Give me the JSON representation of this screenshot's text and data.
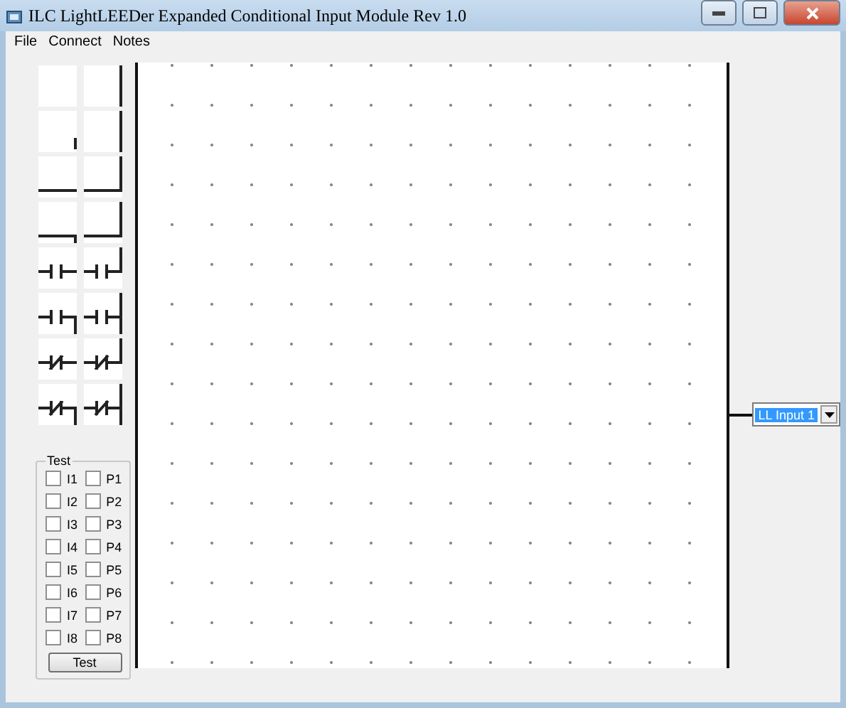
{
  "window": {
    "title": "ILC LightLEEDer Expanded Conditional Input Module Rev 1.0"
  },
  "menu": [
    "File",
    "Connect",
    "Notes"
  ],
  "palette": [
    {
      "kind": "blank"
    },
    {
      "kind": "rail"
    },
    {
      "kind": "stub"
    },
    {
      "kind": "rail"
    },
    {
      "kind": "wire"
    },
    {
      "kind": "wire_up"
    },
    {
      "kind": "wire_down"
    },
    {
      "kind": "wire_up"
    },
    {
      "kind": "contact"
    },
    {
      "kind": "contact_up"
    },
    {
      "kind": "contact_down"
    },
    {
      "kind": "contact_rail"
    },
    {
      "kind": "nc_contact"
    },
    {
      "kind": "nc_contact_up"
    },
    {
      "kind": "nc_contact_down"
    },
    {
      "kind": "nc_contact_rail"
    }
  ],
  "test": {
    "title": "Test",
    "inputs": [
      {
        "label": "I1",
        "checked": false
      },
      {
        "label": "P1",
        "checked": false
      },
      {
        "label": "I2",
        "checked": false
      },
      {
        "label": "P2",
        "checked": false
      },
      {
        "label": "I3",
        "checked": false
      },
      {
        "label": "P3",
        "checked": false
      },
      {
        "label": "I4",
        "checked": false
      },
      {
        "label": "P4",
        "checked": false
      },
      {
        "label": "I5",
        "checked": false
      },
      {
        "label": "P5",
        "checked": false
      },
      {
        "label": "I6",
        "checked": false
      },
      {
        "label": "P6",
        "checked": false
      },
      {
        "label": "I7",
        "checked": false
      },
      {
        "label": "P7",
        "checked": false
      },
      {
        "label": "I8",
        "checked": false
      },
      {
        "label": "P8",
        "checked": false
      }
    ],
    "button": "Test"
  },
  "output": {
    "value": "LL Input 1",
    "selected": true
  }
}
